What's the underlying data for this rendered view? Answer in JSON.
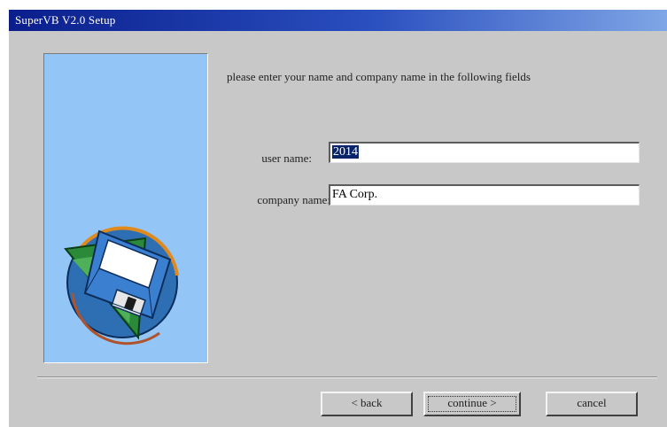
{
  "window": {
    "title": "SuperVB V2.0 Setup"
  },
  "instruction": "please enter your name and company name in the following fields",
  "form": {
    "user_name_label": "user name:",
    "user_name_value": "2014",
    "company_name_label": "company name:",
    "company_name_value": "FA Corp."
  },
  "buttons": {
    "back": "< back",
    "continue": "continue >",
    "cancel": "cancel"
  },
  "icons": [
    "setup-disk-icon"
  ],
  "colors": {
    "title_bar": "#0a1e8c",
    "side_panel": "#93c6f6",
    "dialog_bg": "#c8c8c8",
    "selection": "#0a246a"
  }
}
